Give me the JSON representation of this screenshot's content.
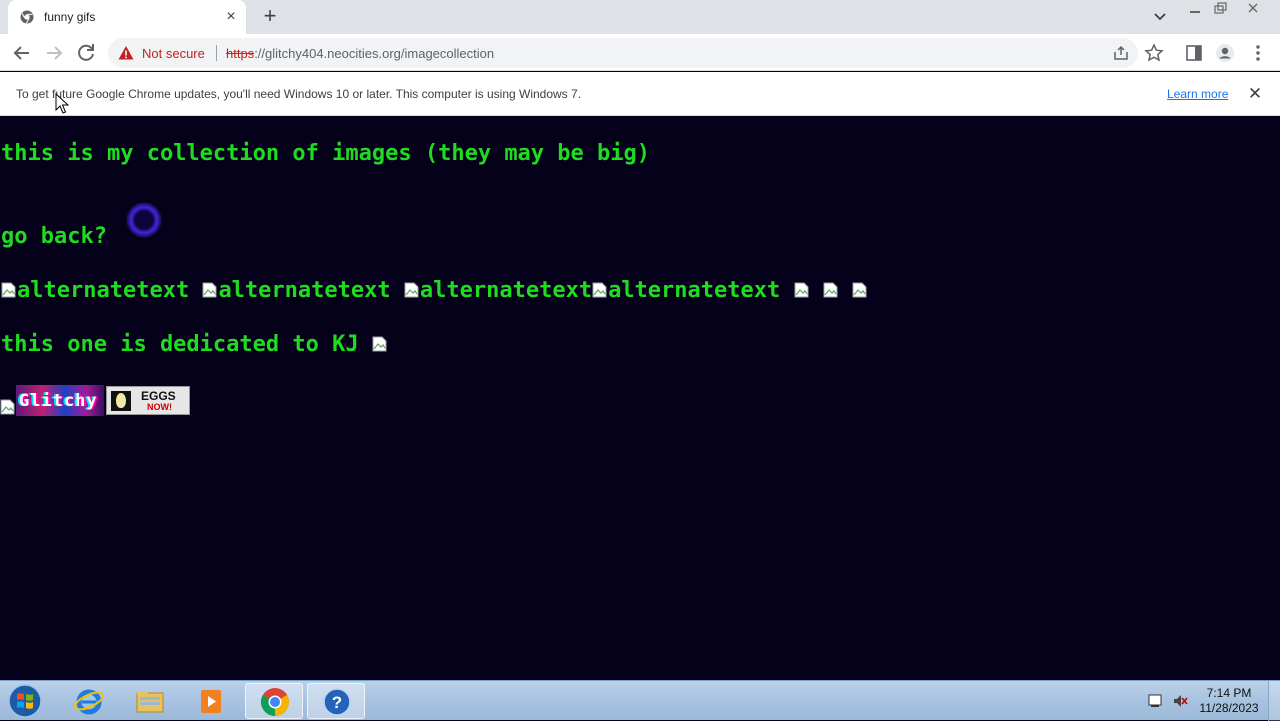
{
  "browser": {
    "tab": {
      "title": "funny gifs"
    },
    "address": {
      "security_label": "Not secure",
      "scheme": "https",
      "rest": "://glitchy404.neocities.org/imagecollection"
    },
    "infobar": {
      "message": "To get future Google Chrome updates, you'll need Windows 10 or later. This computer is using Windows 7.",
      "link_label": "Learn more"
    }
  },
  "page": {
    "heading": "this is my collection of images (they may be big)",
    "go_back": "go back?",
    "images": [
      {
        "alt": "alternatetext"
      },
      {
        "alt": "alternatetext"
      },
      {
        "alt": "alternatetext"
      },
      {
        "alt": "alternatetext"
      }
    ],
    "dedication": "this one is dedicated to KJ",
    "badges": {
      "glitchy": "Glitchy",
      "eggs": "EGGS",
      "eggs_sub": "NOW!"
    }
  },
  "taskbar": {
    "time": "7:14 PM",
    "date": "11/28/2023"
  },
  "colors": {
    "page_background": "#06011b",
    "page_text": "#1edc1e",
    "not_secure": "#c5221f",
    "link": "#1a73e8"
  },
  "icons": [
    "chrome-favicon",
    "close-icon",
    "plus-icon",
    "chevron-down-icon",
    "back-arrow-icon",
    "forward-arrow-icon",
    "reload-icon",
    "warning-icon",
    "share-icon",
    "star-icon",
    "side-panel-icon",
    "profile-icon",
    "more-vert-icon",
    "broken-image-icon",
    "windows-start-icon",
    "internet-explorer-icon",
    "file-explorer-icon",
    "media-player-icon",
    "chrome-icon",
    "help-icon"
  ]
}
